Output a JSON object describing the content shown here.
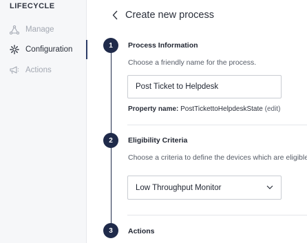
{
  "sidebar": {
    "heading": "LIFECYCLE",
    "items": [
      {
        "label": "Manage",
        "icon": "triangle-nodes-icon",
        "active": false
      },
      {
        "label": "Configuration",
        "icon": "gear-icon",
        "active": true
      },
      {
        "label": "Actions",
        "icon": "megaphone-icon",
        "active": false
      }
    ]
  },
  "header": {
    "title": "Create new process",
    "back_icon": "chevron-left-icon"
  },
  "steps": [
    {
      "number": "1",
      "title": "Process Information",
      "description": "Choose a friendly name for the process.",
      "input_value": "Post Ticket to Helpdesk",
      "property_label": "Property name:",
      "property_value": "PostTickettoHelpdeskState",
      "edit_label": "(edit)"
    },
    {
      "number": "2",
      "title": "Eligibility Criteria",
      "description": "Choose a criteria to define the devices which are eligible",
      "select_value": "Low Throughput Monitor"
    },
    {
      "number": "3",
      "title": "Actions"
    }
  ],
  "colors": {
    "step_accent": "#1f2a4a",
    "sidebar_bg": "#f6f7f9",
    "muted_text": "#a3a8b2"
  }
}
